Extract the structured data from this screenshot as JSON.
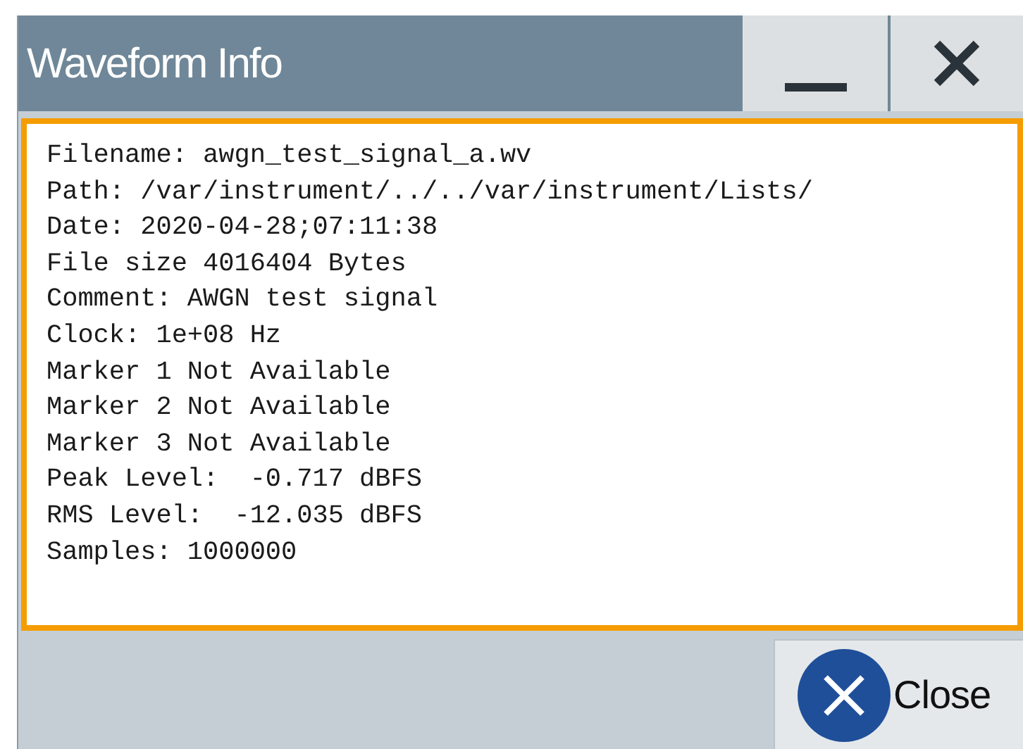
{
  "window": {
    "title": "Waveform Info"
  },
  "info_lines": [
    "Filename: awgn_test_signal_a.wv",
    "Path: /var/instrument/../../var/instrument/Lists/",
    "Date: 2020-04-28;07:11:38",
    "File size 4016404 Bytes",
    "Comment: AWGN test signal",
    "Clock: 1e+08 Hz",
    "Marker 1 Not Available",
    "Marker 2 Not Available",
    "Marker 3 Not Available",
    "Peak Level:  -0.717 dBFS",
    "RMS Level:  -12.035 dBFS",
    "Samples: 1000000"
  ],
  "buttons": [
    {
      "label": "Close"
    }
  ]
}
